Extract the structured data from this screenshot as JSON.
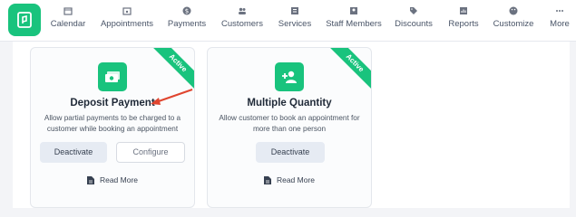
{
  "nav": {
    "items": [
      {
        "label": "Calendar",
        "icon": "calendar-icon"
      },
      {
        "label": "Appointments",
        "icon": "appointments-icon"
      },
      {
        "label": "Payments",
        "icon": "dollar-icon"
      },
      {
        "label": "Customers",
        "icon": "users-icon"
      },
      {
        "label": "Services",
        "icon": "list-icon"
      },
      {
        "label": "Staff Members",
        "icon": "staff-icon"
      },
      {
        "label": "Discounts",
        "icon": "tag-icon"
      },
      {
        "label": "Reports",
        "icon": "report-icon"
      },
      {
        "label": "Customize",
        "icon": "palette-icon"
      },
      {
        "label": "More",
        "icon": "more-icon"
      }
    ]
  },
  "cards": [
    {
      "title": "Deposit Payment",
      "badge": "Active",
      "description": "Allow partial payments to be charged to a customer while booking an appointment",
      "primary_button": "Deactivate",
      "secondary_button": "Configure",
      "read_more": "Read More",
      "icon": "money-icon"
    },
    {
      "title": "Multiple Quantity",
      "badge": "Active",
      "description": "Allow customer to book an appointment for more than one person",
      "primary_button": "Deactivate",
      "read_more": "Read More",
      "icon": "add-user-icon"
    }
  ],
  "colors": {
    "accent": "#19c37d",
    "annotation": "#e0452f"
  }
}
